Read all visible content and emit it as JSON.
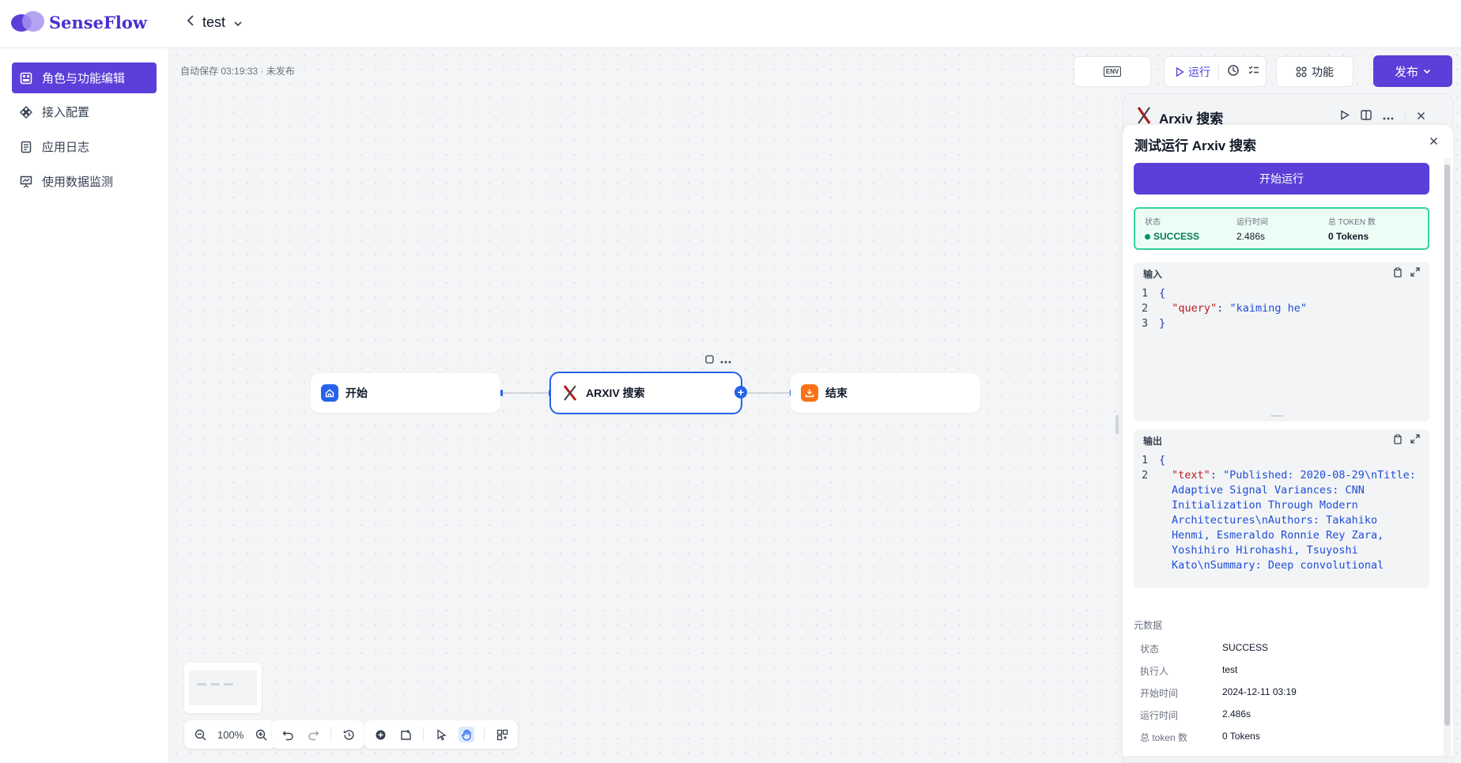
{
  "brand": {
    "name": "SenseFlow"
  },
  "header": {
    "app_name": "test"
  },
  "sidebar": {
    "items": [
      {
        "label": "角色与功能编辑",
        "active": true
      },
      {
        "label": "接入配置",
        "active": false
      },
      {
        "label": "应用日志",
        "active": false
      },
      {
        "label": "使用数据监测",
        "active": false
      }
    ]
  },
  "canvas": {
    "autosave_text": "自动保存 03:19:33 · 未发布",
    "nodes": {
      "start": "开始",
      "arxiv": "ARXIV 搜索",
      "end": "结束"
    }
  },
  "toolbar": {
    "env_badge": "ENV",
    "run_label": "运行",
    "func_label": "功能",
    "publish_label": "发布"
  },
  "bottom": {
    "zoom": "100%"
  },
  "panel": {
    "back_title": "Arxiv 搜索",
    "title": "测试运行 Arxiv 搜索",
    "start_button": "开始运行",
    "status": {
      "state_label": "状态",
      "state_value": "SUCCESS",
      "time_label": "运行时间",
      "time_value": "2.486s",
      "token_label": "总 TOKEN 数",
      "token_value": "0 Tokens"
    },
    "input": {
      "label": "输入",
      "line1": "{",
      "key": "\"query\"",
      "value": "\"kaiming he\"",
      "line3": "}"
    },
    "output": {
      "label": "输出",
      "line1": "{",
      "key": "\"text\"",
      "value": "\"Published: 2020-08-29\\nTitle: Adaptive Signal Variances: CNN Initialization Through Modern Architectures\\nAuthors: Takahiko Henmi, Esmeraldo Ronnie Rey Zara, Yoshihiro Hirohashi, Tsuyoshi Kato\\nSummary: Deep convolutional"
    },
    "metadata": {
      "title": "元数据",
      "rows": [
        {
          "k": "状态",
          "v": "SUCCESS"
        },
        {
          "k": "执行人",
          "v": "test"
        },
        {
          "k": "开始时间",
          "v": "2024-12-11 03:19"
        },
        {
          "k": "运行时间",
          "v": "2.486s"
        },
        {
          "k": "总 token 数",
          "v": "0 Tokens"
        }
      ]
    }
  },
  "colors": {
    "brand": "#5b3fd8",
    "accent_blue": "#2563eb",
    "success": "#059669"
  }
}
